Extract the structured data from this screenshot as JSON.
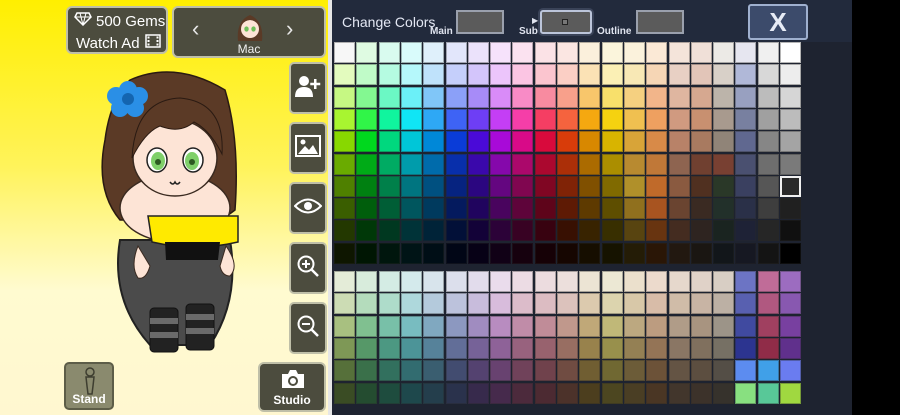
{
  "hud": {
    "gems_label": "500 Gems",
    "watch_ad_label": "Watch Ad",
    "character_name": "Mac",
    "prev_icon": "chevron-left-icon",
    "next_icon": "chevron-right-icon"
  },
  "side_buttons": [
    {
      "name": "add-character-button",
      "icon": "add-person-icon"
    },
    {
      "name": "background-button",
      "icon": "image-icon"
    },
    {
      "name": "visibility-button",
      "icon": "eye-icon"
    },
    {
      "name": "zoom-in-button",
      "icon": "zoom-in-icon"
    },
    {
      "name": "zoom-out-button",
      "icon": "zoom-out-icon"
    }
  ],
  "bottom_buttons": {
    "stand_label": "Stand",
    "studio_label": "Studio"
  },
  "color_panel": {
    "title": "Change Colors",
    "main_label": "Main",
    "sub_label": "Sub",
    "outline_label": "Outline",
    "main_color": "#5b5b5b",
    "sub_color": "#5b5b5b",
    "outline_color": "#5b5b5b",
    "close_label": "X",
    "selected_index": [
      6,
      20
    ]
  },
  "palette": {
    "rows": 16,
    "cols": 21,
    "colors": [
      [
        "#f7f7f7",
        "#dffbe2",
        "#d9fbef",
        "#d9fbfb",
        "#dff0fb",
        "#e2e6fb",
        "#ebe2fb",
        "#f6e2fb",
        "#fbe2f0",
        "#fbe2e6",
        "#fbe6e2",
        "#fbf0dc",
        "#fbf5dc",
        "#fbf2dc",
        "#fbe9d6",
        "#f4e4da",
        "#f0e0d8",
        "#eceae6",
        "#e6e6f0",
        "#f0f0f0",
        "#ffffff"
      ],
      [
        "#e3fbbe",
        "#c0fbc8",
        "#b5fbe1",
        "#b5f8fb",
        "#bfe2fb",
        "#c5cffb",
        "#d3c5fb",
        "#ecc5fb",
        "#fbc5e3",
        "#fbc5cf",
        "#fbcfc5",
        "#fbe2b5",
        "#fbf0b5",
        "#f8e8b5",
        "#f6d6b5",
        "#e8d0c4",
        "#e2c5b8",
        "#d8d0c8",
        "#b0b8d8",
        "#d8d8d8",
        "#ededed"
      ],
      [
        "#c6f883",
        "#83f891",
        "#6bf8c4",
        "#6bf0f8",
        "#80c6f8",
        "#8ba0f8",
        "#a78bf8",
        "#d98bf8",
        "#f88bc6",
        "#f88ba0",
        "#f8a08b",
        "#f8c66b",
        "#f8e06b",
        "#f5d080",
        "#f2b58a",
        "#dfb6a0",
        "#d6a890",
        "#bcb4aa",
        "#98a0c0",
        "#bcbcbc",
        "#d6d6d6"
      ],
      [
        "#a8f530",
        "#30f548",
        "#10f59e",
        "#10e5f5",
        "#2ea8f5",
        "#3e63f5",
        "#6e3ef5",
        "#c43ef5",
        "#f53ea8",
        "#f53e63",
        "#f5633e",
        "#f5a810",
        "#f5d210",
        "#f0c050",
        "#eea060",
        "#d09a80",
        "#c89070",
        "#a89a8e",
        "#7880a0",
        "#a0a0a0",
        "#bcbcbc"
      ],
      [
        "#88d800",
        "#00d81e",
        "#00d87e",
        "#00c6d8",
        "#0088d8",
        "#0a3cd8",
        "#4a0ad8",
        "#a80ad8",
        "#d80a88",
        "#d80a3c",
        "#d83c0a",
        "#d88800",
        "#d8b400",
        "#d8a438",
        "#d88a48",
        "#b88268",
        "#a87a60",
        "#908478",
        "#606890",
        "#868686",
        "#a4a4a4"
      ],
      [
        "#6aab00",
        "#00ab17",
        "#00ab63",
        "#009cab",
        "#006bab",
        "#082fab",
        "#3a08ab",
        "#8508ab",
        "#ab086b",
        "#ab082f",
        "#ab2f08",
        "#ab6b00",
        "#ab8e00",
        "#b88a30",
        "#c07838",
        "#8e6450",
        "#704030",
        "#784032",
        "#4a5070",
        "#6e6e6e",
        "#7a7a7a"
      ],
      [
        "#4f8000",
        "#008011",
        "#00804a",
        "#007580",
        "#005080",
        "#062380",
        "#2b0680",
        "#640680",
        "#800650",
        "#800623",
        "#802306",
        "#805000",
        "#806a00",
        "#b0902a",
        "#c06a2a",
        "#8a5a40",
        "#503020",
        "#2a3828",
        "#3a4060",
        "#565656",
        "#2a2a2a"
      ],
      [
        "#3a5e00",
        "#005e0c",
        "#005e36",
        "#00565e",
        "#003a5e",
        "#041a5e",
        "#20045e",
        "#49045e",
        "#5e043a",
        "#5e041a",
        "#5e1a04",
        "#5e3a00",
        "#5e4e00",
        "#90701e",
        "#a85420",
        "#6a4430",
        "#3a2a22",
        "#22302a",
        "#2a3048",
        "#3e3e3e",
        "#202020"
      ],
      [
        "#233800",
        "#003808",
        "#003820",
        "#003338",
        "#002338",
        "#021038",
        "#130238",
        "#2c0238",
        "#380223",
        "#380210",
        "#381002",
        "#382300",
        "#382f00",
        "#584410",
        "#683410",
        "#442c20",
        "#2e2420",
        "#1a2420",
        "#1e2236",
        "#262626",
        "#101010"
      ],
      [
        "#0e1600",
        "#001603",
        "#00160d",
        "#001416",
        "#000e16",
        "#010616",
        "#070116",
        "#110116",
        "#16010e",
        "#160106",
        "#160601",
        "#160e00",
        "#161300",
        "#241c06",
        "#2a1606",
        "#221810",
        "#1a1612",
        "#12161a",
        "#161822",
        "#141414",
        "#000000"
      ],
      [
        "#e4ecd8",
        "#d8ecdc",
        "#d4ece4",
        "#d4eaec",
        "#d8e4ec",
        "#dcdfec",
        "#e2dcec",
        "#eadcec",
        "#ecdce4",
        "#ecdcdf",
        "#ecdfdc",
        "#ece4d4",
        "#ece8d4",
        "#ebe0cc",
        "#ecdacc",
        "#e6d8cc",
        "#e0d2c8",
        "#d8cec4",
        "#6c74c4",
        "#c06c98",
        "#9c6cc0"
      ],
      [
        "#ccdcb4",
        "#b4dcbc",
        "#aedcca",
        "#aed8dc",
        "#b4cadc",
        "#bcc2dc",
        "#c8bcdc",
        "#d8bcdc",
        "#dcbcca",
        "#dcbcc2",
        "#dcc2bc",
        "#dccaae",
        "#dcd4ae",
        "#d8c8a8",
        "#d8bca8",
        "#d0bca8",
        "#c8b4a4",
        "#bcb0a4",
        "#5860b0",
        "#b05880",
        "#8858b0"
      ],
      [
        "#a8c080",
        "#80c090",
        "#78c0a8",
        "#78bcc0",
        "#80a8c0",
        "#8c98c0",
        "#a08cc0",
        "#b88cc0",
        "#c08ca8",
        "#c08c98",
        "#c0988c",
        "#c0a878",
        "#c0b878",
        "#bca880",
        "#bc9c80",
        "#b09c88",
        "#a89480",
        "#9c9488",
        "#404aa0",
        "#a04060",
        "#7840a0"
      ],
      [
        "#7e9856",
        "#569868",
        "#4c9882",
        "#4c9498",
        "#56829a",
        "#626e98",
        "#766298",
        "#8e6298",
        "#98627e",
        "#98626e",
        "#986e62",
        "#98824c",
        "#98904c",
        "#948054",
        "#947456",
        "#8a7664",
        "#80705e",
        "#767064",
        "#2c3490",
        "#902c48",
        "#60308c"
      ],
      [
        "#56703a",
        "#3a704a",
        "#32705e",
        "#326c70",
        "#3a5e70",
        "#424c70",
        "#544270",
        "#684270",
        "#70425a",
        "#70424c",
        "#704c42",
        "#705e32",
        "#706832",
        "#6c5c38",
        "#6c5238",
        "#645444",
        "#5c4e40",
        "#544e46",
        "#5c8cf0",
        "#40a0e8",
        "#6a7cf0"
      ],
      [
        "#3a4c24",
        "#244c30",
        "#1e4c3e",
        "#1e484c",
        "#243e4c",
        "#2a324c",
        "#372a4c",
        "#462a4c",
        "#4c2a3c",
        "#4c2a32",
        "#4c322a",
        "#4c3e1e",
        "#4c4620",
        "#4a3e24",
        "#4a3624",
        "#42362c",
        "#3c322a",
        "#36322c",
        "#88e080",
        "#58c898",
        "#a0d840"
      ]
    ]
  }
}
